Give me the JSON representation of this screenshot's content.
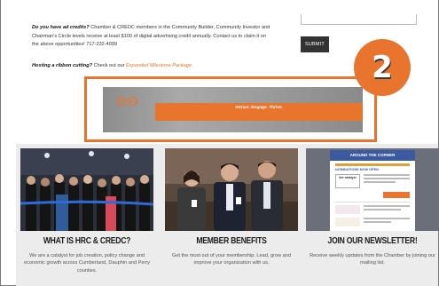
{
  "ad_credits": {
    "lead": "Do you have ad credits?",
    "body": "Chamber & CREDC members in the Community Builder, Community Investor and Chairman's Circle levels receive at least $100 of digital advertising credit annually. Contact us to claim it on the above opportunities! 717-232-4099"
  },
  "ribbon": {
    "lead": "Hosting a ribbon cutting?",
    "body": " Check out our ",
    "link": "Expanded Milestone Package."
  },
  "form": {
    "submit_label": "SUBMIT"
  },
  "step_badge": "2",
  "banner": {
    "title": "Attract. Engage. Thrive."
  },
  "cards": [
    {
      "title": "WHAT IS HRC & CREDC?",
      "desc": "We are a catalyst for job creation, policy change and economic growth across Cumberland, Dauphin and Perry counties."
    },
    {
      "title": "MEMBER BENEFITS",
      "desc": "Get the most out of your membership. Lead, grow and improve your organization with us."
    },
    {
      "title": "JOIN OUR NEWSLETTER!",
      "desc": "Receive weekly updates from the Chamber by joining our mailing list.",
      "newsletter_header": "AROUND THE CORNER",
      "newsletter_sub": "NOMINATIONS NOW OPEN"
    }
  ],
  "colors": {
    "accent": "#e8742e",
    "dark_button": "#333333",
    "card_bg": "#ececec"
  }
}
